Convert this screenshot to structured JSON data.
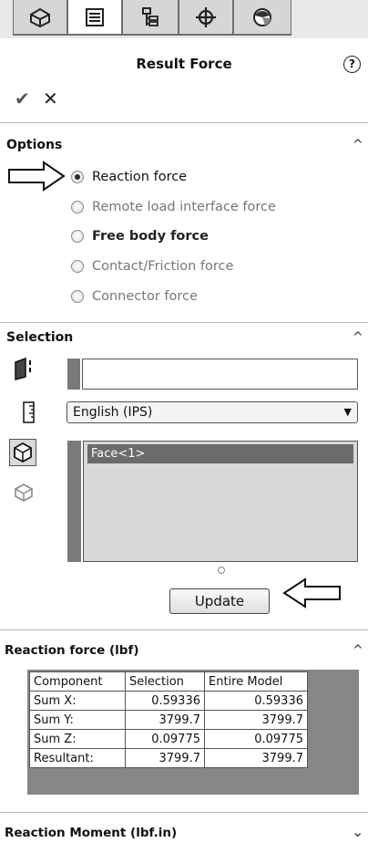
{
  "panel": {
    "title": "Result Force",
    "tabs": [
      "feature-manager-icon",
      "property-manager-icon",
      "configuration-manager-icon",
      "dim-xpert-icon",
      "display-manager-icon"
    ]
  },
  "options": {
    "title": "Options",
    "radios": [
      {
        "label": "Reaction force",
        "checked": true
      },
      {
        "label": "Remote load interface force",
        "checked": false
      },
      {
        "label": "Free body force",
        "checked": false
      },
      {
        "label": "Contact/Friction force",
        "checked": false
      },
      {
        "label": "Connector force",
        "checked": false
      }
    ]
  },
  "selection": {
    "title": "Selection",
    "entity_value": "",
    "units": "English (IPS)",
    "list_items": [
      "Face<1>"
    ],
    "update_label": "Update"
  },
  "reaction_force": {
    "title": "Reaction force (lbf)",
    "headers": [
      "Component",
      "Selection",
      "Entire Model"
    ],
    "rows": [
      [
        "Sum X:",
        "0.59336",
        "0.59336"
      ],
      [
        "Sum Y:",
        "3799.7",
        "3799.7"
      ],
      [
        "Sum Z:",
        "0.09775",
        "0.09775"
      ],
      [
        "Resultant:",
        "3799.7",
        "3799.7"
      ]
    ]
  },
  "reaction_moment": {
    "title": "Reaction Moment (lbf.in)"
  }
}
